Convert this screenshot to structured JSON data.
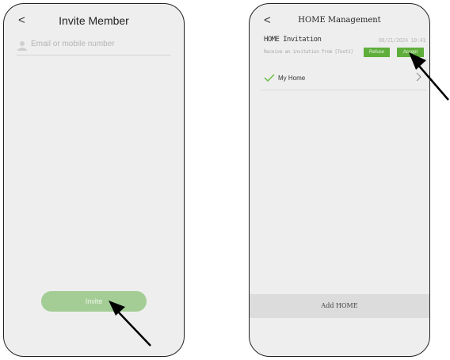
{
  "left_screen": {
    "back_symbol": "<",
    "title": "Invite Member",
    "email_placeholder": "Email or mobile number",
    "email_value": "",
    "invite_label": "Invite"
  },
  "right_screen": {
    "back_symbol": "<",
    "title": "HOME  Management",
    "invitation": {
      "title": "HOME Invitation",
      "date": "08/21/2024 10:41",
      "message": "Receive an invitation from [Test1]",
      "refuse_label": "Refuse",
      "accept_label": "Accept"
    },
    "home_item": {
      "label": "My Home",
      "chevron": ">"
    },
    "add_home_label": "Add HOME"
  },
  "colors": {
    "accent_green": "#5fae3b",
    "light_green": "#a4cd96",
    "screen_bg": "#eeeeee"
  },
  "icons": [
    "person-icon",
    "check-icon",
    "chevron-right-icon",
    "pointer-arrow-icon"
  ]
}
